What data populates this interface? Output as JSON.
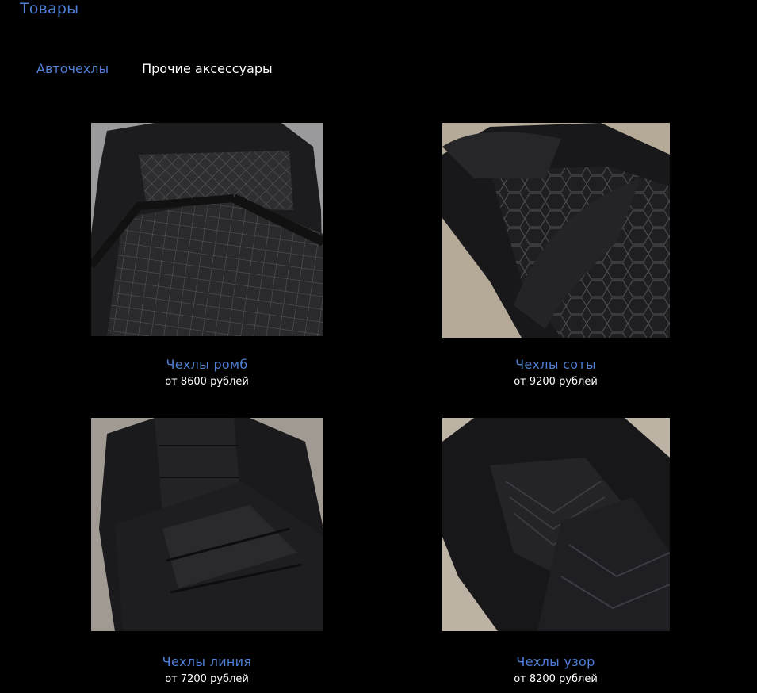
{
  "page": {
    "title": "Товары"
  },
  "tabs": [
    {
      "label": "Авточехлы"
    },
    {
      "label": "Прочие аксессуары"
    }
  ],
  "products": [
    {
      "name": "Чехлы ромб",
      "price": "от 8600 рублей",
      "image_icon": "seat-cover-rhombus-image"
    },
    {
      "name": "Чехлы соты",
      "price": "от 9200 рублей",
      "image_icon": "seat-cover-honeycomb-image"
    },
    {
      "name": "Чехлы линия",
      "price": "от 7200 рублей",
      "image_icon": "seat-cover-line-image"
    },
    {
      "name": "Чехлы узор",
      "price": "от 8200 рублей",
      "image_icon": "seat-cover-pattern-image"
    }
  ],
  "colors": {
    "background": "#000000",
    "accent": "#4f7fd6",
    "text": "#ffffff"
  }
}
